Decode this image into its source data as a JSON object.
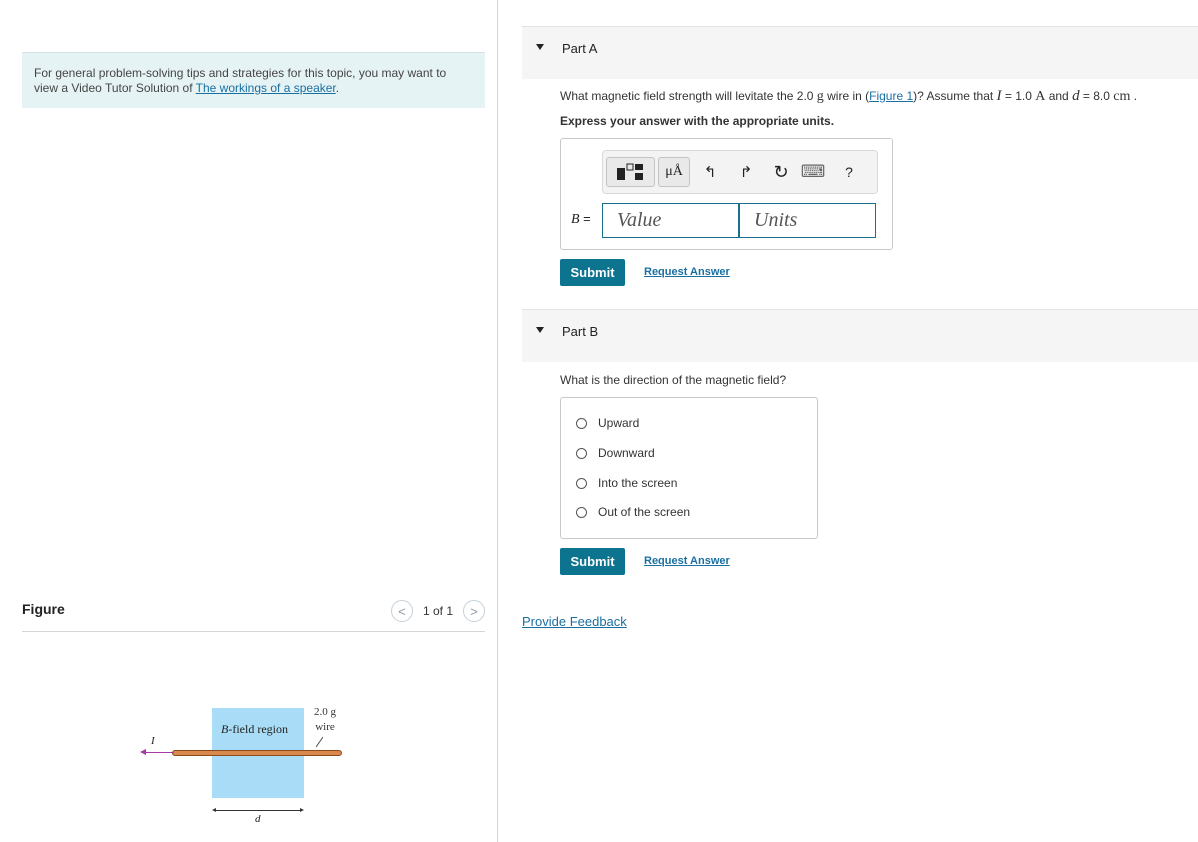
{
  "tip": {
    "text": "For general problem-solving tips and strategies for this topic, you may want to view a Video Tutor Solution of ",
    "link": "The workings of a speaker",
    "end": "."
  },
  "figure": {
    "title": "Figure",
    "pager_prev": "<",
    "pager_next": ">",
    "pager_count": "1 of 1",
    "bfield_label_var": "B",
    "bfield_label_rest": "-field region",
    "wire_mass": "2.0 g",
    "wire_word": "wire",
    "current_symbol": "I",
    "distance_symbol": "d"
  },
  "partA": {
    "label": "Part A",
    "q_pre": "What magnetic field strength will levitate the 2.0 ",
    "q_unit_g": "g",
    "q_mid": " wire in (",
    "q_figlink": "Figure 1",
    "q_post": ")? Assume that ",
    "q_I": "I",
    "q_eq1": " = 1.0 ",
    "q_A": "A",
    "q_and": " and ",
    "q_d": "d",
    "q_eq2": " = 8.0 ",
    "q_cm": "cm",
    "q_end": " .",
    "instruction": "Express your answer with the appropriate units.",
    "toolbar": {
      "templates_icon": "templates-icon",
      "units_glyph": "μÅ",
      "undo_glyph": "↰",
      "redo_glyph": "↱",
      "reset_glyph": "↻",
      "keyboard_glyph": "⌨",
      "help_glyph": "?"
    },
    "var_label": "B",
    "eq_sign": " =",
    "value_placeholder": "Value",
    "units_placeholder": "Units",
    "submit": "Submit",
    "request": "Request Answer"
  },
  "partB": {
    "label": "Part B",
    "question": "What is the direction of the magnetic field?",
    "options": [
      "Upward",
      "Downward",
      "Into the screen",
      "Out of the screen"
    ],
    "submit": "Submit",
    "request": "Request Answer"
  },
  "feedback": "Provide Feedback",
  "colors": {
    "accent": "#0d7490",
    "link": "#1a6fa1",
    "tip_bg": "#e6f3f5",
    "bfield": "#a9dcf7",
    "wire": "#d9894b",
    "current_arrow": "#a43aa8"
  }
}
